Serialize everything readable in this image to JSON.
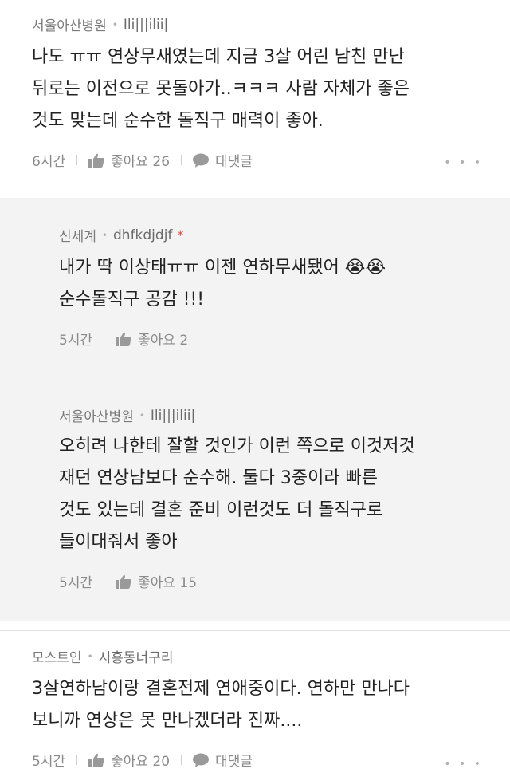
{
  "comments": [
    {
      "board": "서울아산병원",
      "author": "Ili|||ilii|",
      "lines": [
        "나도 ㅠㅠ 연상무새였는데 지금 3살 어린 남친 만난",
        "뒤로는 이전으로 못돌아가..ㅋㅋㅋ 사람 자체가 좋은",
        "것도 맞는데 순수한 돌직구 매력이 좋아."
      ],
      "time": "6시간",
      "like_label": "좋아요 26",
      "reply_label": "대댓글",
      "more": "• • •"
    },
    {
      "board": "신세계",
      "author": "dhfkdjdjf",
      "author_mark": "*",
      "lines": [
        "내가 딱 이상태ㅠㅠ 이젠 연하무새됐어 😭😭",
        "순수돌직구 공감 !!!"
      ],
      "time": "5시간",
      "like_label": "좋아요 2"
    },
    {
      "board": "서울아산병원",
      "author": "Ili|||ilii|",
      "lines": [
        "오히려 나한테 잘할 것인가 이런 쪽으로 이것저것",
        "재던 연상남보다 순수해. 둘다 3중이라 빠른",
        "것도 있는데 결혼 준비 이런것도 더 돌직구로",
        "들이대줘서 좋아"
      ],
      "time": "5시간",
      "like_label": "좋아요 15"
    },
    {
      "board": "모스트인",
      "author": "시흥동너구리",
      "lines": [
        "3살연하남이랑 결혼전제 연애중이다. 연하만 만나다",
        "보니까 연상은 못 만나겠더라 진짜...."
      ],
      "time": "5시간",
      "like_label": "좋아요 20",
      "reply_label": "대댓글",
      "more": "• • •"
    }
  ],
  "icons": {
    "like": "thumbs-up-icon",
    "reply": "speech-bubble-icon",
    "more": "more-dots-icon"
  }
}
